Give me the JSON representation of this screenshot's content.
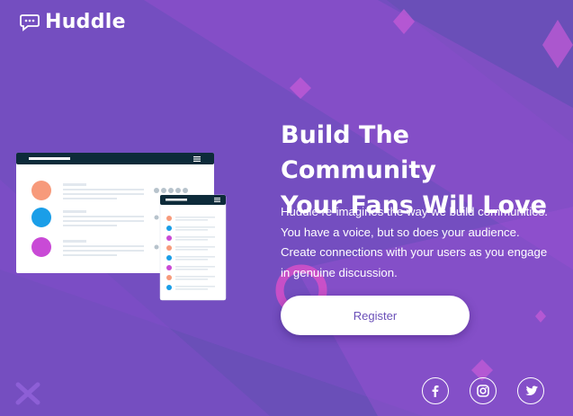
{
  "brand": {
    "name": "Huddle",
    "logo_icon": "chat-bubble-icon"
  },
  "hero": {
    "headline_line1": "Build The Community",
    "headline_line2": "Your Fans Will Love",
    "description": "Huddle re-imagines the way we build communities. You have a voice, but so does your audience. Create connections with your users as you engage in genuine discussion.",
    "cta_label": "Register"
  },
  "social": [
    {
      "name": "facebook",
      "icon": "facebook-icon"
    },
    {
      "name": "instagram",
      "icon": "instagram-icon"
    },
    {
      "name": "twitter",
      "icon": "twitter-icon"
    }
  ],
  "colors": {
    "background": "#6a4fb8",
    "accent_magenta": "#c04fd1",
    "text": "#ffffff",
    "button_text": "#6a4fb8"
  }
}
